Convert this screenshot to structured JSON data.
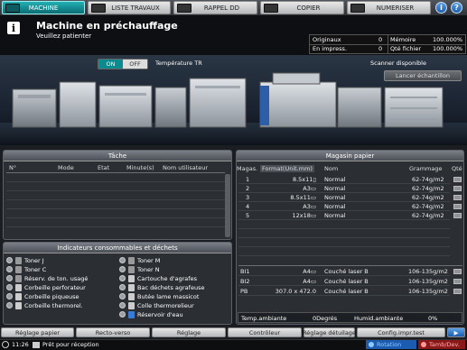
{
  "tabs": [
    {
      "label": "MACHINE"
    },
    {
      "label": "LISTE TRAVAUX"
    },
    {
      "label": "RAPPEL DD"
    },
    {
      "label": "COPIER"
    },
    {
      "label": "NUMERISER"
    }
  ],
  "header": {
    "title": "Machine en préchauffage",
    "subtitle": "Veuillez patienter"
  },
  "counters": {
    "originaux_label": "Originaux",
    "originaux_value": "0",
    "memoire_label": "Mémoire",
    "memoire_value": "100.000%",
    "en_impress_label": "En impress.",
    "en_impress_value": "0",
    "qte_fichier_label": "Qté fichier",
    "qte_fichier_value": "100.000%"
  },
  "machine": {
    "toggle_on": "ON",
    "toggle_off": "OFF",
    "temperature_label": "Température TR",
    "scanner_status": "Scanner disponible",
    "sample_button": "Lancer échantillon"
  },
  "task_panel": {
    "title": "Tâche",
    "columns": [
      "N°",
      "Mode",
      "Etat",
      "Minute(s)",
      "Nom utilisateur"
    ]
  },
  "consumables": {
    "title": "Indicateurs consommables et déchets",
    "left": [
      "Toner J",
      "Toner C",
      "Réserv. de ton. usagé",
      "Corbeille perforateur",
      "Corbeille piqueuse",
      "Corbeille thermorel."
    ],
    "right": [
      "Toner M",
      "Toner N",
      "Cartouche d'agrafes",
      "Bac déchets agrafeuse",
      "Butée lame massicot",
      "Colle thermorelieur",
      "Réservoir d'eau"
    ]
  },
  "paper": {
    "title": "Magasin papier",
    "columns": [
      "Magas.",
      "Format(Unit.mm)",
      "Nom",
      "Grammage",
      "Qté"
    ],
    "trays": [
      {
        "magas": "1",
        "format": "8.5x11▯",
        "nom": "Normal",
        "grammage": "62-74g/m2"
      },
      {
        "magas": "2",
        "format": "A3▭",
        "nom": "Normal",
        "grammage": "62-74g/m2"
      },
      {
        "magas": "3",
        "format": "8.5x11▭",
        "nom": "Normal",
        "grammage": "62-74g/m2"
      },
      {
        "magas": "4",
        "format": "A3▭",
        "nom": "Normal",
        "grammage": "62-74g/m2"
      },
      {
        "magas": "5",
        "format": "12x18▭",
        "nom": "Normal",
        "grammage": "62-74g/m2"
      }
    ],
    "bypass": [
      {
        "magas": "BI1",
        "format": "A4▭",
        "nom": "Couché laser B",
        "grammage": "106-135g/m2"
      },
      {
        "magas": "BI2",
        "format": "A4▭",
        "nom": "Couché laser B",
        "grammage": "106-135g/m2"
      },
      {
        "magas": "PB",
        "format": "307.0 x 472.0",
        "nom": "Couché laser B",
        "grammage": "106-135g/m2"
      }
    ],
    "temp_label": "Temp.ambiante",
    "temp_value": "0Degrés",
    "humid_label": "Humid.ambiante",
    "humid_value": "0%"
  },
  "bottom_buttons": [
    "Réglage papier",
    "Recto-verso",
    "Réglage",
    "Contrôleur",
    "Réglage détuilage",
    "Config.impr.test"
  ],
  "status": {
    "time": "11:26",
    "message": "Prêt pour réception",
    "rotation": "Rotation",
    "tamb": "Tamb/Dev."
  }
}
